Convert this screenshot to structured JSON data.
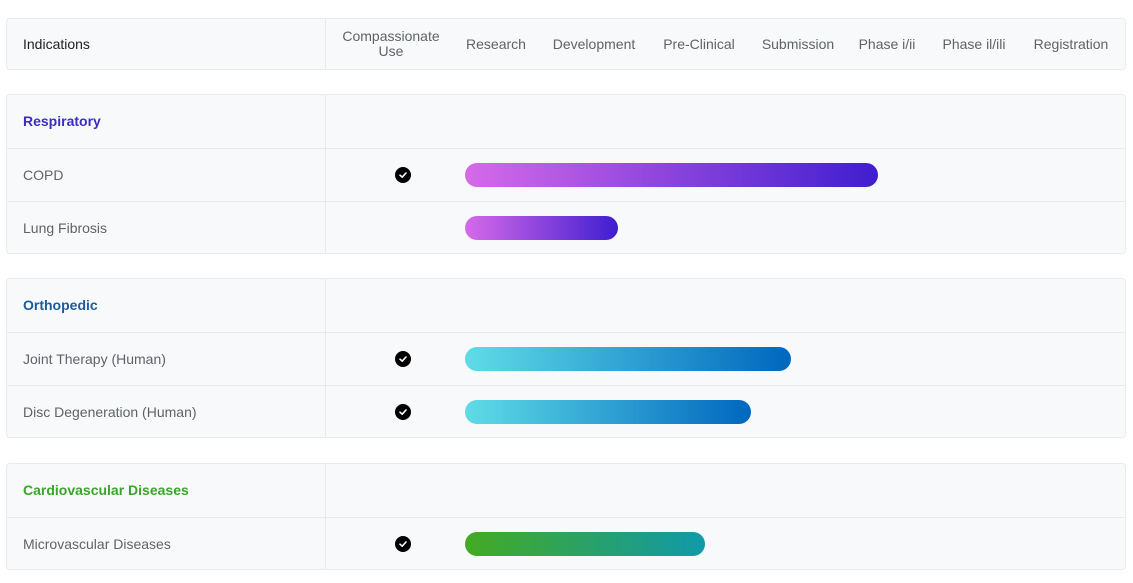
{
  "header": {
    "indications_label": "Indications",
    "columns": [
      "Compassionate Use",
      "Research",
      "Development",
      "Pre-Clinical",
      "Submission",
      "Phase i/ii",
      "Phase il/ili",
      "Registration"
    ]
  },
  "groups": [
    {
      "category": "Respiratory",
      "color": "#3b2cc4",
      "gradient": [
        "#d66ae9",
        "#3f1ed0"
      ],
      "items": [
        {
          "name": "COPD",
          "compassionate_use": true,
          "progress_pct": 62.4
        },
        {
          "name": "Lung Fibrosis",
          "compassionate_use": false,
          "progress_pct": 23.1
        }
      ]
    },
    {
      "category": "Orthopedic",
      "color": "#1c5a9e",
      "gradient": [
        "#5fdce6",
        "#0067be"
      ],
      "items": [
        {
          "name": "Joint Therapy (Human)",
          "compassionate_use": true,
          "progress_pct": 49.3
        },
        {
          "name": "Disc Degeneration (Human)",
          "compassionate_use": true,
          "progress_pct": 43.2
        }
      ]
    },
    {
      "category": "Cardiovascular Diseases",
      "color": "#3aa52b",
      "gradient": [
        "#44aa22",
        "#1099aa"
      ],
      "items": [
        {
          "name": "Microvascular Diseases",
          "compassionate_use": true,
          "progress_pct": 36.3
        }
      ]
    }
  ]
}
